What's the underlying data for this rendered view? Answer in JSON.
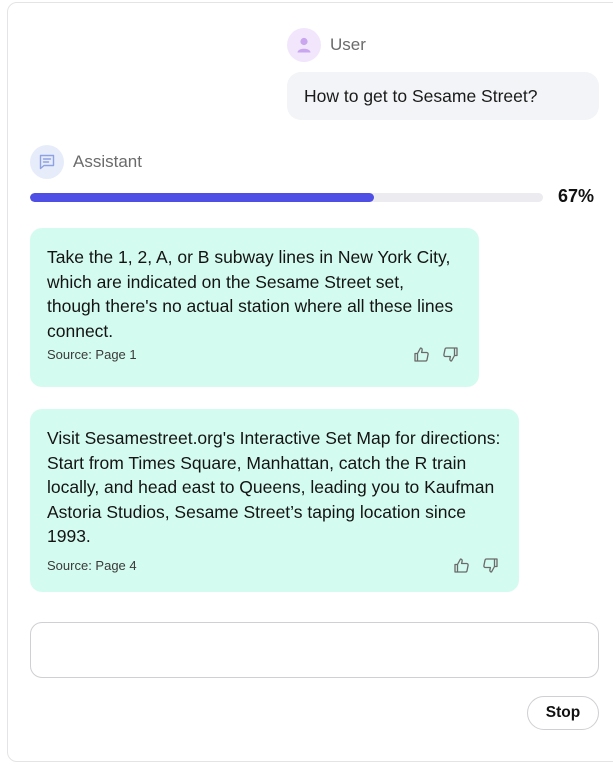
{
  "user_message": {
    "role_label": "User",
    "text": "How to get to Sesame Street?"
  },
  "assistant": {
    "role_label": "Assistant",
    "progress_percent": 67,
    "progress_label": "67%",
    "answers": [
      {
        "text": "Take the 1, 2, A, or B subway lines in New York City, which are indicated on the Sesame Street set, though there's no actual station where all these lines connect.",
        "source": "Source: Page 1"
      },
      {
        "text": "Visit Sesamestreet.org's Interactive Set Map for directions: Start from Times Square, Manhattan, catch the R train locally, and head east to Queens, leading you to Kaufman Astoria Studios, Sesame Street’s taping location since 1993.",
        "source": "Source: Page 4"
      }
    ]
  },
  "composer": {
    "input_value": "",
    "stop_label": "Stop"
  },
  "colors": {
    "accent": "#4f4fe6",
    "answer_bg": "#d4fbef",
    "user_bubble_bg": "#f3f4f7"
  },
  "icons": {
    "user_avatar": "person-icon",
    "assistant_avatar": "chat-message-icon",
    "like": "thumbs-up-icon",
    "dislike": "thumbs-down-icon"
  }
}
